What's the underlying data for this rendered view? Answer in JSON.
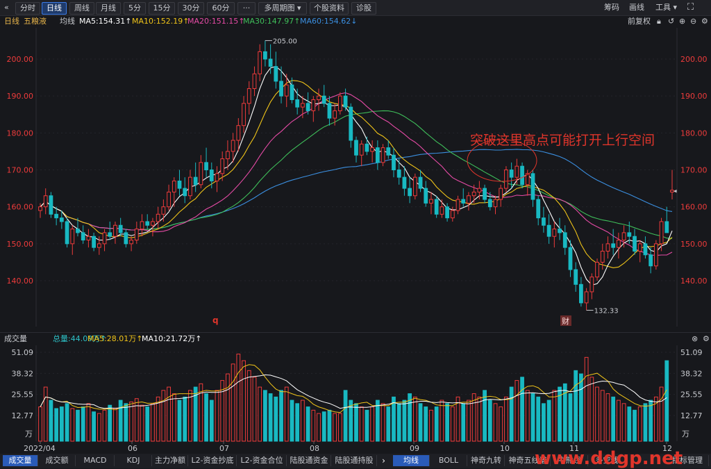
{
  "toolbar": {
    "back_icon": "«",
    "period_tabs": [
      "分时",
      "日线",
      "周线",
      "月线",
      "5分",
      "15分",
      "30分",
      "60分",
      "···",
      "多周期图 ▾",
      "个股资料",
      "诊股"
    ],
    "active_tab": "日线",
    "right_items": [
      "筹码",
      "画线",
      "工具 ▾"
    ],
    "expand_icon": "⛶"
  },
  "ma_bar": {
    "period": "日线",
    "stock_name": "五粮液",
    "indicator": "均线",
    "ma5": "MA5:154.31↑",
    "ma10": "MA10:152.19↑",
    "ma20": "MA20:151.15↑",
    "ma30": "MA30:147.97↑",
    "ma60": "MA60:154.62↓",
    "adjust": "前复权",
    "colors": {
      "ma5": "#ffffff",
      "ma10": "#f0c419",
      "ma20": "#e64ba6",
      "ma30": "#3fbf5a",
      "ma60": "#3b8fe0"
    }
  },
  "price_axis": {
    "ticks": [
      "200.00",
      "190.00",
      "180.00",
      "170.00",
      "160.00",
      "150.00",
      "140.00"
    ]
  },
  "annotations": {
    "high_label": "205.00",
    "low_label": "132.33",
    "callout": "突破这里高点可能打开上行空间",
    "marker_q": "q",
    "marker_cai": "财"
  },
  "volume_bar": {
    "title": "成交量",
    "total": "总量:44.09万↑",
    "ma5": "MA5:28.01万↑",
    "ma10": "MA10:21.72万↑",
    "ticks": [
      "51.09",
      "38.32",
      "25.55",
      "12.77"
    ],
    "unit": "万"
  },
  "x_axis": {
    "labels": [
      "2022/04",
      "06",
      "07",
      "08",
      "09",
      "10",
      "11",
      "12"
    ]
  },
  "bottom_tabs_left": [
    "成交量",
    "成交额",
    "MACD",
    "KDJ",
    "主力净额",
    "L2-资金抄底",
    "L2-资金合位",
    "陆股通资金",
    "陆股通持股"
  ],
  "bottom_tabs_right": [
    "均线",
    "BOLL",
    "神奇九转",
    "神奇五线谱",
    "牛熊线",
    "多空线",
    "指标管理"
  ],
  "watermark": "www.ddgp.net",
  "chart_data": {
    "type": "candlestick",
    "title": "五粮液 日线",
    "ylim": [
      128,
      210
    ],
    "grid": false,
    "ohlc": [
      [
        159,
        161,
        157,
        160
      ],
      [
        160,
        165,
        158,
        163
      ],
      [
        163,
        164,
        157,
        158
      ],
      [
        158,
        160,
        155,
        157
      ],
      [
        157,
        159,
        154,
        156
      ],
      [
        156,
        157,
        149,
        150
      ],
      [
        150,
        155,
        147,
        154
      ],
      [
        154,
        157,
        152,
        153
      ],
      [
        153,
        155,
        150,
        151
      ],
      [
        151,
        154,
        149,
        152
      ],
      [
        152,
        153,
        148,
        149
      ],
      [
        149,
        152,
        147,
        150
      ],
      [
        150,
        154,
        148,
        153
      ],
      [
        153,
        156,
        151,
        152
      ],
      [
        152,
        156,
        150,
        155
      ],
      [
        155,
        157,
        152,
        153
      ],
      [
        153,
        154,
        149,
        150
      ],
      [
        150,
        152,
        148,
        151
      ],
      [
        151,
        156,
        150,
        154
      ],
      [
        154,
        158,
        152,
        156
      ],
      [
        156,
        158,
        154,
        155
      ],
      [
        155,
        157,
        152,
        156
      ],
      [
        156,
        160,
        154,
        158
      ],
      [
        158,
        162,
        156,
        160
      ],
      [
        160,
        166,
        159,
        164
      ],
      [
        164,
        168,
        160,
        167
      ],
      [
        167,
        170,
        163,
        165
      ],
      [
        165,
        168,
        161,
        163
      ],
      [
        163,
        170,
        162,
        168
      ],
      [
        168,
        172,
        164,
        166
      ],
      [
        166,
        174,
        165,
        172
      ],
      [
        172,
        176,
        168,
        170
      ],
      [
        170,
        172,
        165,
        167
      ],
      [
        167,
        171,
        164,
        169
      ],
      [
        169,
        175,
        167,
        173
      ],
      [
        173,
        178,
        170,
        175
      ],
      [
        175,
        180,
        172,
        178
      ],
      [
        178,
        184,
        175,
        182
      ],
      [
        182,
        190,
        180,
        188
      ],
      [
        188,
        194,
        185,
        192
      ],
      [
        192,
        198,
        190,
        196
      ],
      [
        196,
        204,
        194,
        202
      ],
      [
        202,
        205,
        198,
        200
      ],
      [
        200,
        204,
        196,
        198
      ],
      [
        198,
        202,
        192,
        194
      ],
      [
        194,
        198,
        188,
        190
      ],
      [
        190,
        196,
        187,
        193
      ],
      [
        193,
        195,
        188,
        189
      ],
      [
        189,
        192,
        185,
        187
      ],
      [
        187,
        190,
        184,
        188
      ],
      [
        188,
        191,
        185,
        186
      ],
      [
        186,
        190,
        183,
        189
      ],
      [
        189,
        192,
        186,
        190
      ],
      [
        190,
        193,
        187,
        188
      ],
      [
        188,
        190,
        182,
        184
      ],
      [
        184,
        188,
        182,
        186
      ],
      [
        186,
        191,
        185,
        190
      ],
      [
        190,
        192,
        186,
        187
      ],
      [
        187,
        188,
        176,
        178
      ],
      [
        178,
        179,
        172,
        174
      ],
      [
        174,
        178,
        171,
        177
      ],
      [
        177,
        179,
        174,
        175
      ],
      [
        175,
        178,
        172,
        176
      ],
      [
        176,
        178,
        170,
        172
      ],
      [
        172,
        177,
        171,
        176
      ],
      [
        176,
        178,
        173,
        174
      ],
      [
        174,
        176,
        168,
        170
      ],
      [
        170,
        173,
        166,
        168
      ],
      [
        168,
        171,
        163,
        165
      ],
      [
        165,
        168,
        161,
        163
      ],
      [
        163,
        169,
        162,
        168
      ],
      [
        168,
        170,
        164,
        165
      ],
      [
        165,
        167,
        160,
        161
      ],
      [
        161,
        164,
        158,
        162
      ],
      [
        162,
        163,
        157,
        158
      ],
      [
        158,
        162,
        157,
        160
      ],
      [
        160,
        161,
        156,
        157
      ],
      [
        157,
        160,
        156,
        159
      ],
      [
        159,
        163,
        158,
        162
      ],
      [
        162,
        165,
        160,
        161
      ],
      [
        161,
        164,
        159,
        163
      ],
      [
        163,
        166,
        161,
        164
      ],
      [
        164,
        167,
        162,
        165
      ],
      [
        165,
        166,
        161,
        162
      ],
      [
        162,
        164,
        159,
        160
      ],
      [
        160,
        163,
        158,
        162
      ],
      [
        162,
        166,
        160,
        165
      ],
      [
        165,
        171,
        164,
        170
      ],
      [
        170,
        172,
        165,
        168
      ],
      [
        168,
        173,
        166,
        171
      ],
      [
        171,
        172,
        165,
        166
      ],
      [
        166,
        170,
        163,
        169
      ],
      [
        169,
        170,
        160,
        162
      ],
      [
        162,
        163,
        155,
        157
      ],
      [
        157,
        160,
        153,
        155
      ],
      [
        155,
        158,
        150,
        152
      ],
      [
        152,
        156,
        149,
        154
      ],
      [
        154,
        157,
        151,
        153
      ],
      [
        153,
        155,
        147,
        149
      ],
      [
        149,
        151,
        141,
        143
      ],
      [
        143,
        145,
        137,
        139
      ],
      [
        139,
        141,
        133,
        134
      ],
      [
        134,
        138,
        132,
        137
      ],
      [
        137,
        142,
        135,
        141
      ],
      [
        141,
        146,
        140,
        145
      ],
      [
        145,
        150,
        143,
        148
      ],
      [
        148,
        152,
        146,
        150
      ],
      [
        150,
        154,
        147,
        149
      ],
      [
        149,
        153,
        146,
        151
      ],
      [
        151,
        155,
        149,
        153
      ],
      [
        153,
        156,
        150,
        152
      ],
      [
        152,
        154,
        147,
        148
      ],
      [
        148,
        151,
        145,
        150
      ],
      [
        150,
        152,
        146,
        147
      ],
      [
        147,
        149,
        142,
        144
      ],
      [
        144,
        151,
        143,
        150
      ],
      [
        150,
        157,
        148,
        156
      ],
      [
        156,
        160,
        153,
        153
      ],
      [
        164,
        170,
        162,
        164.5
      ]
    ],
    "volume": [
      18,
      30,
      22,
      17,
      18,
      20,
      17,
      16,
      18,
      20,
      15,
      14,
      16,
      19,
      17,
      22,
      20,
      21,
      23,
      19,
      18,
      20,
      24,
      28,
      30,
      26,
      22,
      24,
      28,
      30,
      32,
      26,
      22,
      28,
      34,
      38,
      44,
      50,
      46,
      40,
      36,
      30,
      28,
      26,
      24,
      28,
      30,
      22,
      20,
      22,
      18,
      16,
      14,
      15,
      16,
      14,
      14,
      28,
      22,
      20,
      18,
      16,
      18,
      22,
      20,
      18,
      24,
      20,
      22,
      26,
      24,
      20,
      18,
      16,
      18,
      22,
      20,
      18,
      24,
      20,
      22,
      26,
      24,
      28,
      22,
      20,
      18,
      24,
      30,
      34,
      36,
      28,
      26,
      24,
      20,
      22,
      28,
      30,
      32,
      26,
      40,
      38,
      48,
      36,
      30,
      28,
      26,
      24,
      22,
      20,
      18,
      16,
      18,
      20,
      22,
      24,
      30,
      46
    ]
  }
}
